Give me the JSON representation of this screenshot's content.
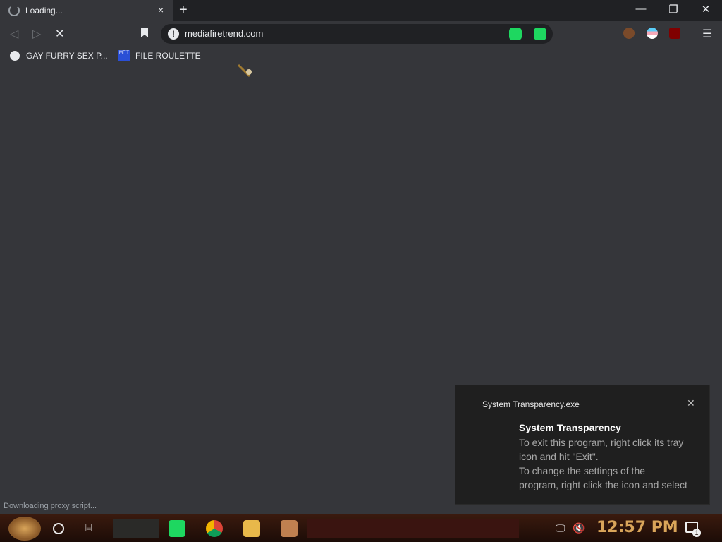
{
  "tab": {
    "title": "Loading...",
    "close": "×",
    "new_tab": "+"
  },
  "window": {
    "minimize": "—",
    "restore": "❐",
    "close": "✕"
  },
  "toolbar": {
    "back": "◁",
    "forward": "▷",
    "stop": "✕",
    "info": "!",
    "url": "mediafiretrend.com",
    "menu": "☰"
  },
  "bookmarks": [
    {
      "label": "GAY FURRY SEX P..."
    },
    {
      "label": "FILE ROULETTE",
      "icon_text": "MF T"
    }
  ],
  "status": "Downloading proxy script...",
  "toast": {
    "app": "System Transparency.exe",
    "close": "✕",
    "title": "System Transparency",
    "lines": [
      "To exit this program, right click its tray",
      "icon and hit \"Exit\".",
      "To change the settings of the",
      "program, right click the icon and select"
    ]
  },
  "taskbar": {
    "time": "12:57 PM",
    "notifications": "1",
    "taskview": "⌸",
    "network": "🖵",
    "volume": "🔇"
  },
  "colors": {
    "accent": "#1ed760",
    "clock": "#d9a55a",
    "bg": "#35363a"
  }
}
